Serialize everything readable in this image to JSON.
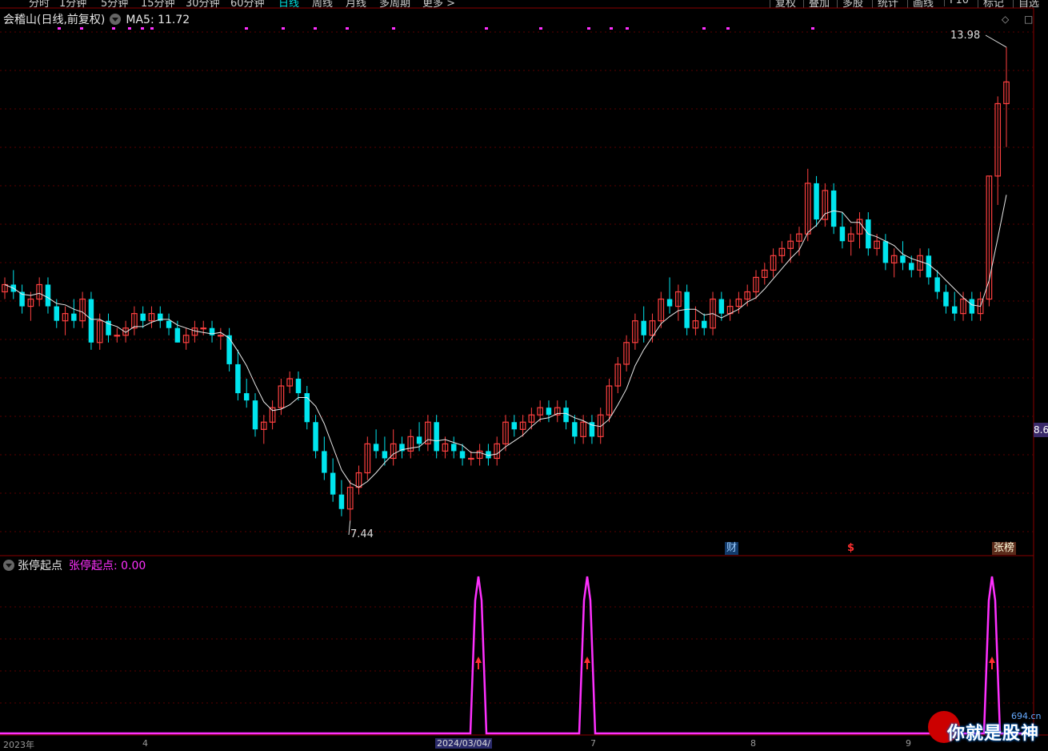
{
  "toolbar": {
    "tabs": [
      "分时",
      "1分钟",
      "5分钟",
      "15分钟",
      "30分钟",
      "60分钟",
      "日线",
      "周线",
      "月线",
      "多周期",
      "更多 >"
    ],
    "active_tab": "日线",
    "right_tabs": [
      "复权",
      "叠加",
      "多股",
      "统计",
      "画线",
      "F10",
      "标记",
      "自选"
    ]
  },
  "main_chart": {
    "stock_name": "会稽山",
    "chart_mode": "(日线,前复权)",
    "ma_label": "MA5: 11.72",
    "high_label": "13.98",
    "low_label": "7.44",
    "current_price_tag": "8.6",
    "markers": {
      "cai": "财",
      "s": "$",
      "zhangbang": "张榜"
    }
  },
  "indicator": {
    "name": "张停起点",
    "value_label": "张停起点: 0.00"
  },
  "x_axis": {
    "labels": [
      "2023年",
      "4",
      "2024/03/04/",
      "7",
      "8",
      "9"
    ],
    "selected": "2024/03/04/"
  },
  "watermark": {
    "text": "你就是股神",
    "site": "694.cn"
  },
  "colors": {
    "up": "#ff4040",
    "down": "#00e5ee",
    "ma": "#e8e8e8",
    "indicator": "#ff30ff",
    "grid": "#5a0000"
  },
  "chart_data": {
    "type": "candlestick",
    "ohlc": [
      [
        10.6,
        10.8,
        10.5,
        10.7
      ],
      [
        10.7,
        10.9,
        10.5,
        10.6
      ],
      [
        10.6,
        10.7,
        10.3,
        10.4
      ],
      [
        10.4,
        10.6,
        10.2,
        10.5
      ],
      [
        10.5,
        10.8,
        10.4,
        10.7
      ],
      [
        10.7,
        10.8,
        10.3,
        10.4
      ],
      [
        10.4,
        10.5,
        10.1,
        10.2
      ],
      [
        10.2,
        10.4,
        10.0,
        10.3
      ],
      [
        10.3,
        10.5,
        10.1,
        10.2
      ],
      [
        10.2,
        10.6,
        10.1,
        10.5
      ],
      [
        10.5,
        10.6,
        9.8,
        9.9
      ],
      [
        9.9,
        10.3,
        9.8,
        10.2
      ],
      [
        10.2,
        10.3,
        9.9,
        10.0
      ],
      [
        10.0,
        10.1,
        9.9,
        10.0
      ],
      [
        10.0,
        10.2,
        9.9,
        10.1
      ],
      [
        10.1,
        10.4,
        10.0,
        10.3
      ],
      [
        10.3,
        10.4,
        10.1,
        10.2
      ],
      [
        10.2,
        10.4,
        10.1,
        10.3
      ],
      [
        10.3,
        10.4,
        10.1,
        10.2
      ],
      [
        10.2,
        10.3,
        10.0,
        10.1
      ],
      [
        10.1,
        10.2,
        9.9,
        9.9
      ],
      [
        9.9,
        10.1,
        9.8,
        10.0
      ],
      [
        10.0,
        10.2,
        9.9,
        10.1
      ],
      [
        10.1,
        10.2,
        10.0,
        10.1
      ],
      [
        10.1,
        10.2,
        9.9,
        10.0
      ],
      [
        10.0,
        10.1,
        9.8,
        10.0
      ],
      [
        10.0,
        10.1,
        9.5,
        9.6
      ],
      [
        9.6,
        9.8,
        9.1,
        9.2
      ],
      [
        9.2,
        9.4,
        9.0,
        9.1
      ],
      [
        9.1,
        9.2,
        8.6,
        8.7
      ],
      [
        8.7,
        8.9,
        8.5,
        8.8
      ],
      [
        8.8,
        9.1,
        8.7,
        9.0
      ],
      [
        9.0,
        9.4,
        8.9,
        9.3
      ],
      [
        9.3,
        9.5,
        9.2,
        9.4
      ],
      [
        9.4,
        9.5,
        9.1,
        9.2
      ],
      [
        9.2,
        9.3,
        8.7,
        8.8
      ],
      [
        8.8,
        8.9,
        8.3,
        8.4
      ],
      [
        8.4,
        8.6,
        8.0,
        8.1
      ],
      [
        8.1,
        8.3,
        7.7,
        7.8
      ],
      [
        7.8,
        8.0,
        7.5,
        7.6
      ],
      [
        7.6,
        8.0,
        7.44,
        7.9
      ],
      [
        7.9,
        8.2,
        7.8,
        8.1
      ],
      [
        8.1,
        8.6,
        8.0,
        8.5
      ],
      [
        8.5,
        8.7,
        8.3,
        8.4
      ],
      [
        8.4,
        8.6,
        8.2,
        8.3
      ],
      [
        8.3,
        8.7,
        8.2,
        8.5
      ],
      [
        8.5,
        8.6,
        8.3,
        8.4
      ],
      [
        8.4,
        8.7,
        8.3,
        8.6
      ],
      [
        8.6,
        8.8,
        8.4,
        8.5
      ],
      [
        8.5,
        8.9,
        8.4,
        8.8
      ],
      [
        8.8,
        8.9,
        8.3,
        8.4
      ],
      [
        8.4,
        8.6,
        8.3,
        8.5
      ],
      [
        8.5,
        8.6,
        8.3,
        8.4
      ],
      [
        8.4,
        8.5,
        8.2,
        8.3
      ],
      [
        8.3,
        8.4,
        8.2,
        8.3
      ],
      [
        8.3,
        8.5,
        8.2,
        8.4
      ],
      [
        8.4,
        8.5,
        8.2,
        8.3
      ],
      [
        8.3,
        8.6,
        8.2,
        8.5
      ],
      [
        8.5,
        8.9,
        8.4,
        8.8
      ],
      [
        8.8,
        8.9,
        8.6,
        8.7
      ],
      [
        8.7,
        8.9,
        8.6,
        8.8
      ],
      [
        8.8,
        9.0,
        8.7,
        8.9
      ],
      [
        8.9,
        9.1,
        8.8,
        9.0
      ],
      [
        9.0,
        9.1,
        8.8,
        8.9
      ],
      [
        8.9,
        9.1,
        8.8,
        9.0
      ],
      [
        9.0,
        9.1,
        8.7,
        8.8
      ],
      [
        8.8,
        8.9,
        8.5,
        8.6
      ],
      [
        8.6,
        8.9,
        8.5,
        8.8
      ],
      [
        8.8,
        8.9,
        8.5,
        8.6
      ],
      [
        8.6,
        9.0,
        8.5,
        8.9
      ],
      [
        8.9,
        9.4,
        8.8,
        9.3
      ],
      [
        9.3,
        9.7,
        9.2,
        9.6
      ],
      [
        9.6,
        10.0,
        9.5,
        9.9
      ],
      [
        9.9,
        10.3,
        9.8,
        10.2
      ],
      [
        10.2,
        10.4,
        9.9,
        10.0
      ],
      [
        10.0,
        10.3,
        9.9,
        10.2
      ],
      [
        10.2,
        10.6,
        10.1,
        10.5
      ],
      [
        10.5,
        10.8,
        10.3,
        10.4
      ],
      [
        10.4,
        10.7,
        10.2,
        10.6
      ],
      [
        10.6,
        10.7,
        10.0,
        10.1
      ],
      [
        10.1,
        10.4,
        10.0,
        10.2
      ],
      [
        10.2,
        10.3,
        10.0,
        10.1
      ],
      [
        10.1,
        10.6,
        10.0,
        10.5
      ],
      [
        10.5,
        10.6,
        10.2,
        10.3
      ],
      [
        10.3,
        10.5,
        10.2,
        10.4
      ],
      [
        10.4,
        10.6,
        10.3,
        10.5
      ],
      [
        10.5,
        10.7,
        10.4,
        10.6
      ],
      [
        10.6,
        10.9,
        10.5,
        10.8
      ],
      [
        10.8,
        11.0,
        10.7,
        10.9
      ],
      [
        10.9,
        11.2,
        10.8,
        11.1
      ],
      [
        11.1,
        11.3,
        11.0,
        11.2
      ],
      [
        11.2,
        11.4,
        11.0,
        11.3
      ],
      [
        11.3,
        11.5,
        11.1,
        11.4
      ],
      [
        11.4,
        12.3,
        11.3,
        12.1
      ],
      [
        12.1,
        12.2,
        11.5,
        11.6
      ],
      [
        11.6,
        12.1,
        11.5,
        12.0
      ],
      [
        12.0,
        12.1,
        11.4,
        11.5
      ],
      [
        11.5,
        11.7,
        11.2,
        11.3
      ],
      [
        11.3,
        11.5,
        11.1,
        11.4
      ],
      [
        11.4,
        11.7,
        11.2,
        11.6
      ],
      [
        11.6,
        11.7,
        11.1,
        11.2
      ],
      [
        11.2,
        11.4,
        11.1,
        11.3
      ],
      [
        11.3,
        11.4,
        10.9,
        11.0
      ],
      [
        11.0,
        11.2,
        10.8,
        11.1
      ],
      [
        11.1,
        11.3,
        10.9,
        11.0
      ],
      [
        11.0,
        11.1,
        10.8,
        10.9
      ],
      [
        10.9,
        11.2,
        10.8,
        11.1
      ],
      [
        11.1,
        11.2,
        10.7,
        10.8
      ],
      [
        10.8,
        10.9,
        10.5,
        10.6
      ],
      [
        10.6,
        10.7,
        10.3,
        10.4
      ],
      [
        10.4,
        10.6,
        10.2,
        10.3
      ],
      [
        10.3,
        10.6,
        10.2,
        10.5
      ],
      [
        10.5,
        10.6,
        10.2,
        10.3
      ],
      [
        10.3,
        10.6,
        10.2,
        10.5
      ],
      [
        10.5,
        12.2,
        10.4,
        12.2
      ],
      [
        12.2,
        13.3,
        11.8,
        13.2
      ],
      [
        13.2,
        13.98,
        12.6,
        13.5
      ]
    ],
    "ma5_last": 11.72,
    "high": 13.98,
    "low": 7.44
  },
  "indicator_data": {
    "type": "line",
    "baseline": 0,
    "spikes": [
      {
        "x_index": 83,
        "value": 1
      },
      {
        "x_index": 102,
        "value": 1
      },
      {
        "x_index": 175,
        "value": 1
      }
    ]
  }
}
